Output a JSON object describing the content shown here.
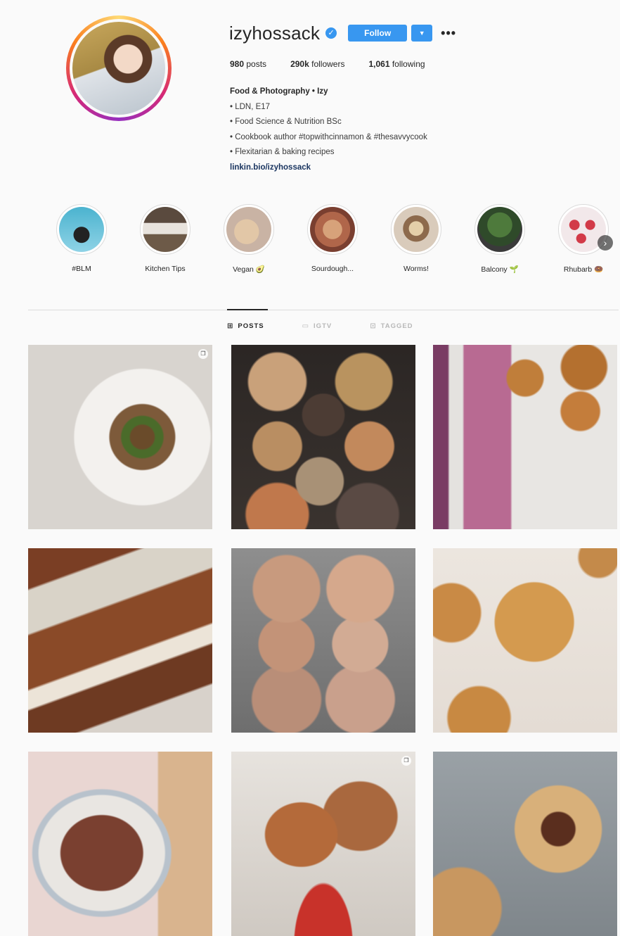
{
  "profile": {
    "username": "izyhossack",
    "follow_label": "Follow",
    "more_label": "•••",
    "dropdown_label": "▼",
    "verified_label": "✓"
  },
  "stats": {
    "posts_count": "980",
    "posts_label": "posts",
    "followers_count": "290k",
    "followers_label": "followers",
    "following_count": "1,061",
    "following_label": "following"
  },
  "bio": {
    "name": "Food & Photography • Izy",
    "lines": [
      "• LDN, E17",
      "• Food Science & Nutrition BSc",
      "• Cookbook author #topwithcinnamon & #thesavvycook",
      "• Flexitarian & baking recipes"
    ],
    "link": "linkin.bio/izyhossack"
  },
  "highlights": [
    {
      "label": "#BLM"
    },
    {
      "label": "Kitchen Tips"
    },
    {
      "label": "Vegan 🥑"
    },
    {
      "label": "Sourdough..."
    },
    {
      "label": "Worms!"
    },
    {
      "label": "Balcony 🌱"
    },
    {
      "label": "Rhubarb 🍩"
    }
  ],
  "tabs": [
    {
      "label": "POSTS",
      "icon": "⊞"
    },
    {
      "label": "IGTV",
      "icon": "▭"
    },
    {
      "label": "TAGGED",
      "icon": "⊡"
    }
  ],
  "posts": [
    {
      "name": "post-cauliflower",
      "multi": true
    },
    {
      "name": "post-bagels",
      "multi": false
    },
    {
      "name": "post-ice-cream-sandwiches",
      "multi": false
    },
    {
      "name": "post-marble-loaf",
      "multi": false
    },
    {
      "name": "post-cinnamon-buns",
      "multi": false
    },
    {
      "name": "post-pies",
      "multi": false
    },
    {
      "name": "post-babka",
      "multi": false
    },
    {
      "name": "post-aubergine",
      "multi": true
    },
    {
      "name": "post-cookies",
      "multi": false
    }
  ]
}
